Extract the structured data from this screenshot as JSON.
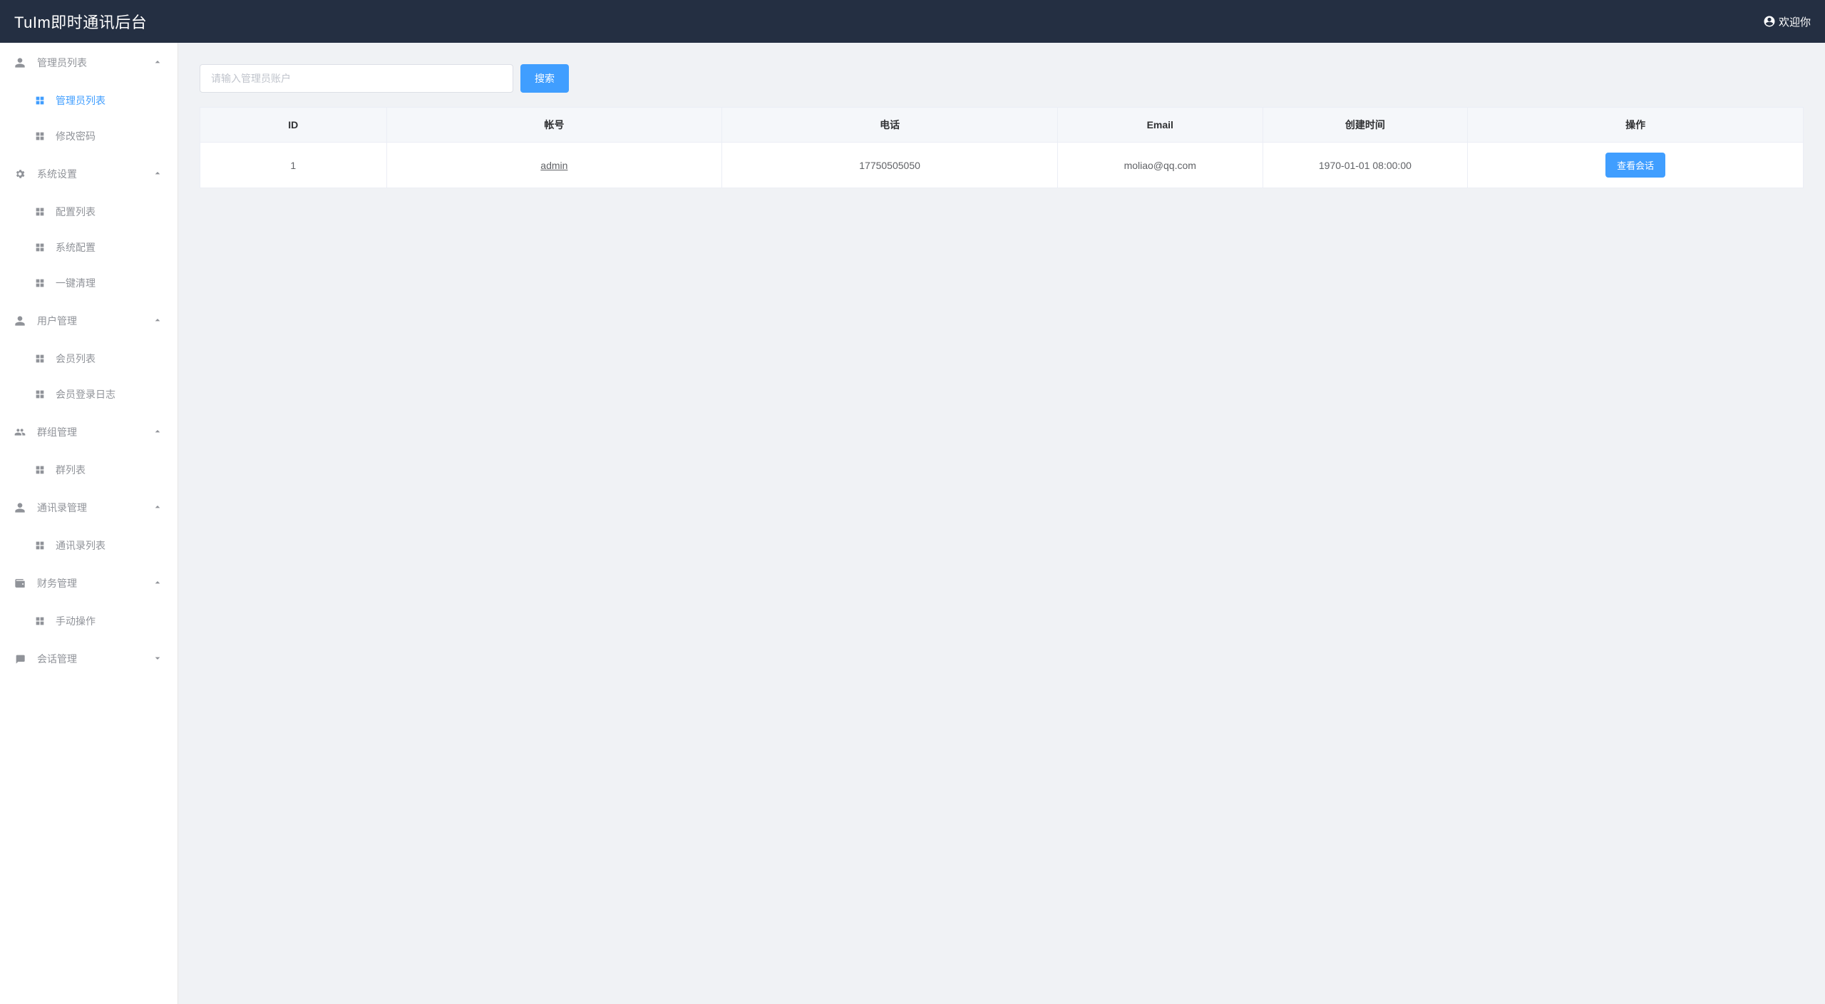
{
  "header": {
    "title": "TuIm即时通讯后台",
    "welcome": "欢迎你"
  },
  "sidebar": {
    "groups": [
      {
        "label": "管理员列表",
        "expanded": true,
        "items": [
          {
            "label": "管理员列表",
            "active": true
          },
          {
            "label": "修改密码",
            "active": false
          }
        ]
      },
      {
        "label": "系统设置",
        "expanded": true,
        "items": [
          {
            "label": "配置列表",
            "active": false
          },
          {
            "label": "系统配置",
            "active": false
          },
          {
            "label": "一键清理",
            "active": false
          }
        ]
      },
      {
        "label": "用户管理",
        "expanded": true,
        "items": [
          {
            "label": "会员列表",
            "active": false
          },
          {
            "label": "会员登录日志",
            "active": false
          }
        ]
      },
      {
        "label": "群组管理",
        "expanded": true,
        "items": [
          {
            "label": "群列表",
            "active": false
          }
        ]
      },
      {
        "label": "通讯录管理",
        "expanded": true,
        "items": [
          {
            "label": "通讯录列表",
            "active": false
          }
        ]
      },
      {
        "label": "财务管理",
        "expanded": true,
        "items": [
          {
            "label": "手动操作",
            "active": false
          }
        ]
      },
      {
        "label": "会话管理",
        "expanded": false,
        "items": []
      }
    ]
  },
  "search": {
    "placeholder": "请输入管理员账户",
    "button": "搜索"
  },
  "table": {
    "headers": {
      "id": "ID",
      "account": "帐号",
      "phone": "电话",
      "email": "Email",
      "created": "创建时间",
      "action": "操作"
    },
    "rows": [
      {
        "id": "1",
        "account": "admin",
        "phone": "17750505050",
        "email": "moliao@qq.com",
        "created": "1970-01-01 08:00:00",
        "action": "查看会话"
      }
    ]
  }
}
